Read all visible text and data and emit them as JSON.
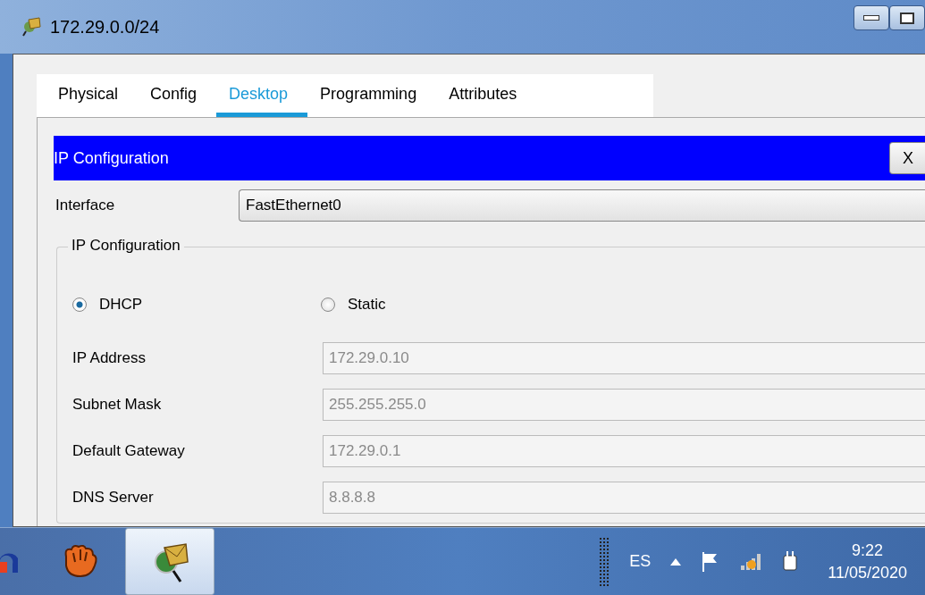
{
  "window": {
    "title": "172.29.0.0/24"
  },
  "tabs": [
    {
      "label": "Physical",
      "selected": false
    },
    {
      "label": "Config",
      "selected": false
    },
    {
      "label": "Desktop",
      "selected": true
    },
    {
      "label": "Programming",
      "selected": false
    },
    {
      "label": "Attributes",
      "selected": false
    }
  ],
  "app": {
    "title": "IP Configuration",
    "close_button": "X"
  },
  "interface": {
    "label": "Interface",
    "value": "FastEthernet0"
  },
  "group": {
    "title": "IP Configuration",
    "modes": [
      {
        "label": "DHCP",
        "selected": true
      },
      {
        "label": "Static",
        "selected": false
      }
    ],
    "fields": [
      {
        "label": "IP Address",
        "value": "172.29.0.10",
        "disabled": true
      },
      {
        "label": "Subnet Mask",
        "value": "255.255.255.0",
        "disabled": true
      },
      {
        "label": "Default Gateway",
        "value": "172.29.0.1",
        "disabled": true
      },
      {
        "label": "DNS Server",
        "value": "8.8.8.8",
        "disabled": true
      }
    ]
  },
  "taskbar": {
    "apps": [
      {
        "kind": "headset",
        "selected": false
      },
      {
        "kind": "glove",
        "selected": false
      },
      {
        "kind": "tracer",
        "selected": true
      }
    ],
    "language": "ES",
    "time": "9:22",
    "date": "11/05/2020"
  }
}
